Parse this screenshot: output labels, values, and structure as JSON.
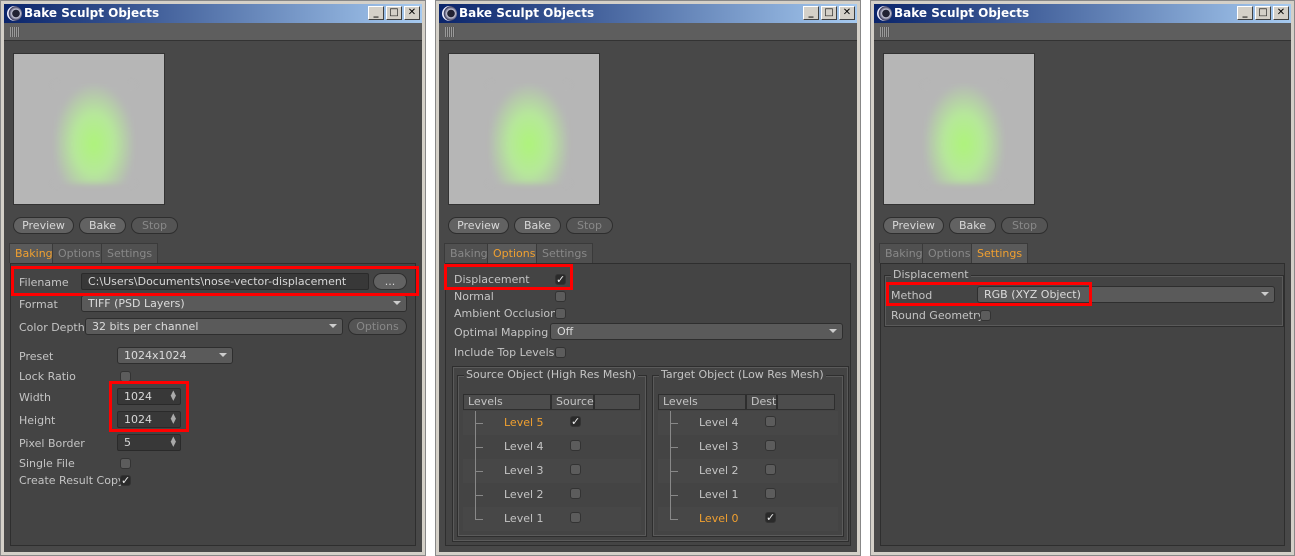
{
  "window_title": "Bake Sculpt Objects",
  "buttons": {
    "preview": "Preview",
    "bake": "Bake",
    "stop": "Stop",
    "browse": "...",
    "options": "Options"
  },
  "tabs": [
    "Baking",
    "Options",
    "Settings"
  ],
  "baking": {
    "filename_label": "Filename",
    "filename": "C:\\Users\\Documents\\nose-vector-displacement",
    "format_label": "Format",
    "format": "TIFF (PSD Layers)",
    "depth_label": "Color Depth",
    "depth": "32 bits per channel",
    "preset_label": "Preset",
    "preset": "1024x1024",
    "lock_label": "Lock Ratio",
    "width_label": "Width",
    "width": "1024",
    "height_label": "Height",
    "height": "1024",
    "border_label": "Pixel Border",
    "border": "5",
    "single_label": "Single File",
    "copy_label": "Create Result Copy"
  },
  "options": {
    "displacement": "Displacement",
    "normal": "Normal",
    "ao": "Ambient Occlusion",
    "optimal_label": "Optimal Mapping",
    "optimal": "Off",
    "top_levels": "Include Top Levels",
    "source_title": "Source Object (High Res Mesh)",
    "target_title": "Target Object (Low Res Mesh)",
    "col_levels": "Levels",
    "col_source": "Source",
    "col_dest": "Dest",
    "source_levels": [
      "Level 5",
      "Level 4",
      "Level 3",
      "Level 2",
      "Level 1"
    ],
    "target_levels": [
      "Level 4",
      "Level 3",
      "Level 2",
      "Level 1",
      "Level 0"
    ]
  },
  "settings": {
    "group": "Displacement",
    "method_label": "Method",
    "method": "RGB (XYZ Object)",
    "round": "Round Geometry"
  },
  "colors": {
    "accent": "#f0a030",
    "highlight": "#ff0000"
  }
}
